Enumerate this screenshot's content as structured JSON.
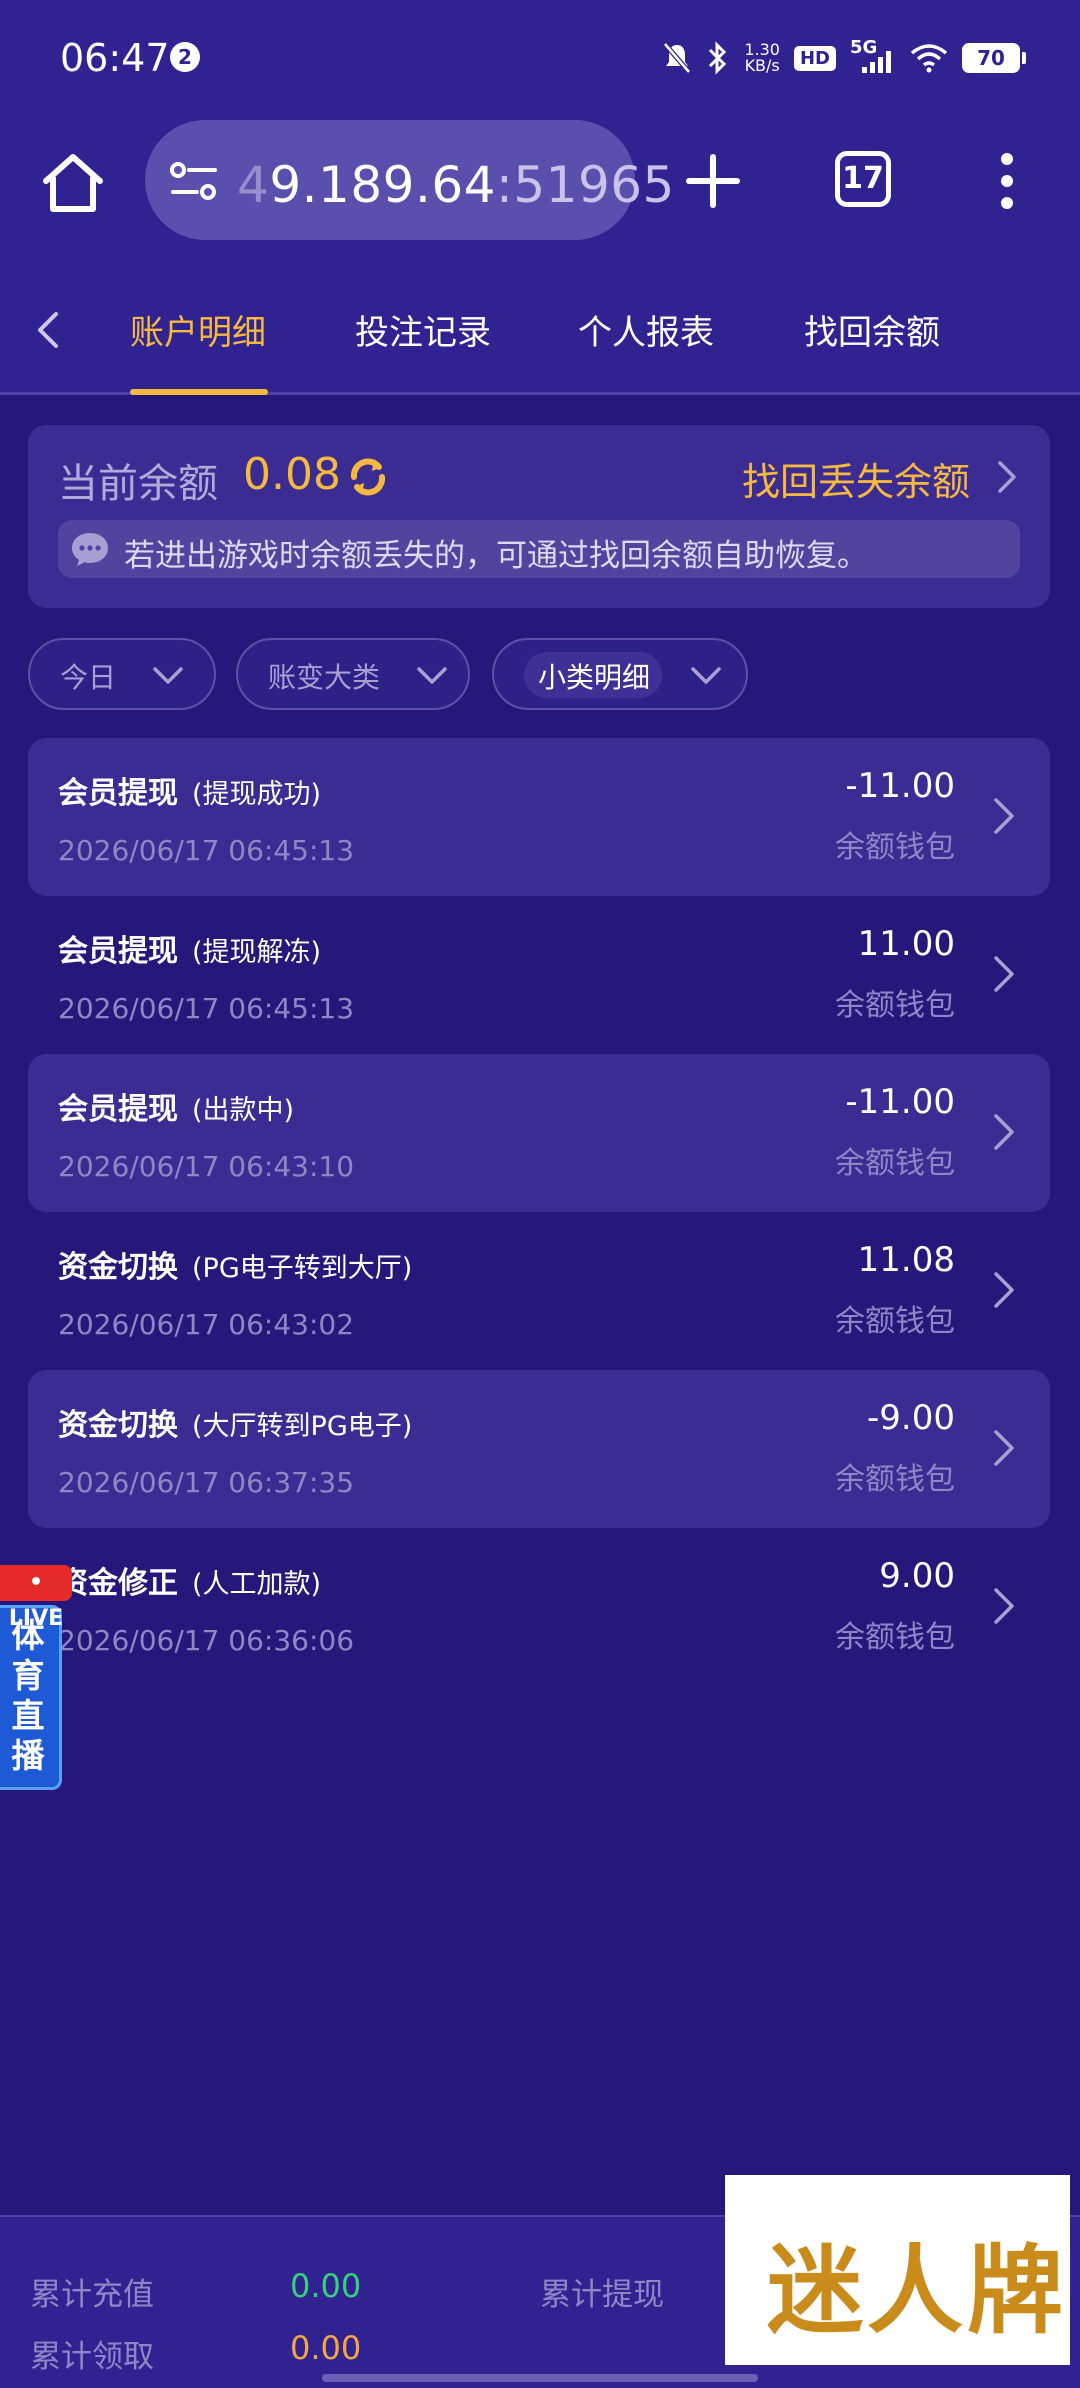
{
  "status_bar": {
    "time": "06:47",
    "notification_count": "2",
    "net_speed_value": "1.30",
    "net_speed_unit": "KB/s",
    "hd_label": "HD",
    "signal_label": "5G",
    "battery": "70"
  },
  "browser": {
    "url_lead": "4",
    "url_main": "9.189.64",
    "url_port": ":51965",
    "tab_count": "17"
  },
  "nav": {
    "tabs": [
      {
        "label": "账户明细",
        "active": true
      },
      {
        "label": "投注记录",
        "active": false
      },
      {
        "label": "个人报表",
        "active": false
      },
      {
        "label": "找回余额",
        "active": false
      }
    ]
  },
  "balance": {
    "label": "当前余额",
    "value": "0.08",
    "recover_link": "找回丢失余额",
    "notice": "若进出游戏时余额丢失的，可通过找回余额自助恢复。"
  },
  "filters": [
    {
      "label": "今日"
    },
    {
      "label": "账变大类"
    },
    {
      "label": "小类明细"
    }
  ],
  "transactions": [
    {
      "title": "会员提现",
      "sub": "(提现成功)",
      "time": "2026/06/17 06:45:13",
      "amount": "-11.00",
      "wallet": "余额钱包"
    },
    {
      "title": "会员提现",
      "sub": "(提现解冻)",
      "time": "2026/06/17 06:45:13",
      "amount": "11.00",
      "wallet": "余额钱包"
    },
    {
      "title": "会员提现",
      "sub": "(出款中)",
      "time": "2026/06/17 06:43:10",
      "amount": "-11.00",
      "wallet": "余额钱包"
    },
    {
      "title": "资金切换",
      "sub": "(PG电子转到大厅)",
      "time": "2026/06/17 06:43:02",
      "amount": "11.08",
      "wallet": "余额钱包"
    },
    {
      "title": "资金切换",
      "sub": "(大厅转到PG电子)",
      "time": "2026/06/17 06:37:35",
      "amount": "-9.00",
      "wallet": "余额钱包"
    },
    {
      "title": "资金修正",
      "sub": "(人工加款)",
      "time": "2026/06/17 06:36:06",
      "amount": "9.00",
      "wallet": "余额钱包"
    }
  ],
  "live_badge": {
    "tag": "• LIVE",
    "text": "体育直播"
  },
  "footer": {
    "recharge_label": "累计充值",
    "recharge_value": "0.00",
    "withdraw_label": "累计提现",
    "claim_label": "累计领取",
    "claim_value": "0.00"
  },
  "watermark": {
    "text": "迷人牌"
  }
}
